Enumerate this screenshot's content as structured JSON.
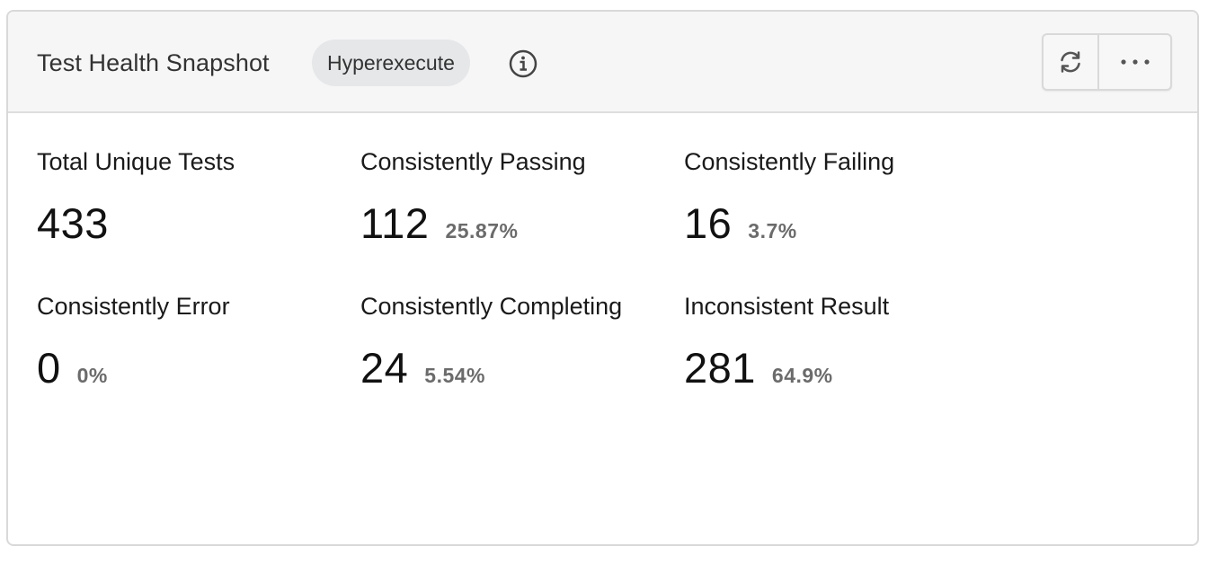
{
  "header": {
    "title": "Test Health Snapshot",
    "badge": "Hyperexecute",
    "info_icon": "info-icon",
    "refresh_icon": "refresh-icon",
    "more_icon": "more-horizontal-icon"
  },
  "metrics": [
    {
      "label": "Total Unique Tests",
      "value": "433",
      "percent": ""
    },
    {
      "label": "Consistently Passing",
      "value": "112",
      "percent": "25.87%"
    },
    {
      "label": "Consistently Failing",
      "value": "16",
      "percent": "3.7%"
    },
    {
      "label": "Consistently Error",
      "value": "0",
      "percent": "0%"
    },
    {
      "label": "Consistently Completing",
      "value": "24",
      "percent": "5.54%"
    },
    {
      "label": "Inconsistent Result",
      "value": "281",
      "percent": "64.9%"
    }
  ]
}
